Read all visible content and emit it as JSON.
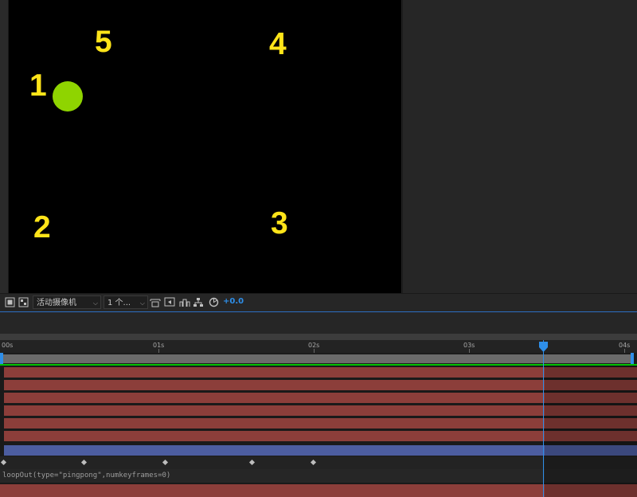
{
  "viewer": {
    "labels": {
      "one": "1",
      "two": "2",
      "three": "3",
      "four": "4",
      "five": "5"
    },
    "label_color": "#ffe419",
    "ball_color": "#8fd400",
    "background": "#000000"
  },
  "toolbar": {
    "camera_dropdown": "活动摄像机",
    "view_dropdown": "1 个...",
    "exposure": "+0.0",
    "icons": [
      "region-icon",
      "transparency-grid-icon",
      "fit-icon",
      "snapshot-icon",
      "show-snapshot-icon",
      "channel-icon",
      "flowchart-icon",
      "reset-exposure-icon"
    ]
  },
  "timeline": {
    "ruler": [
      "00s",
      "01s",
      "02s",
      "03s",
      "04s"
    ],
    "current_time_color": "#2e8ee8",
    "expression": "loopOut(type=\"pingpong\",numkeyframes=0)",
    "layer_colors": {
      "red": "#8c3e3a",
      "blue": "#4c5da0"
    }
  }
}
